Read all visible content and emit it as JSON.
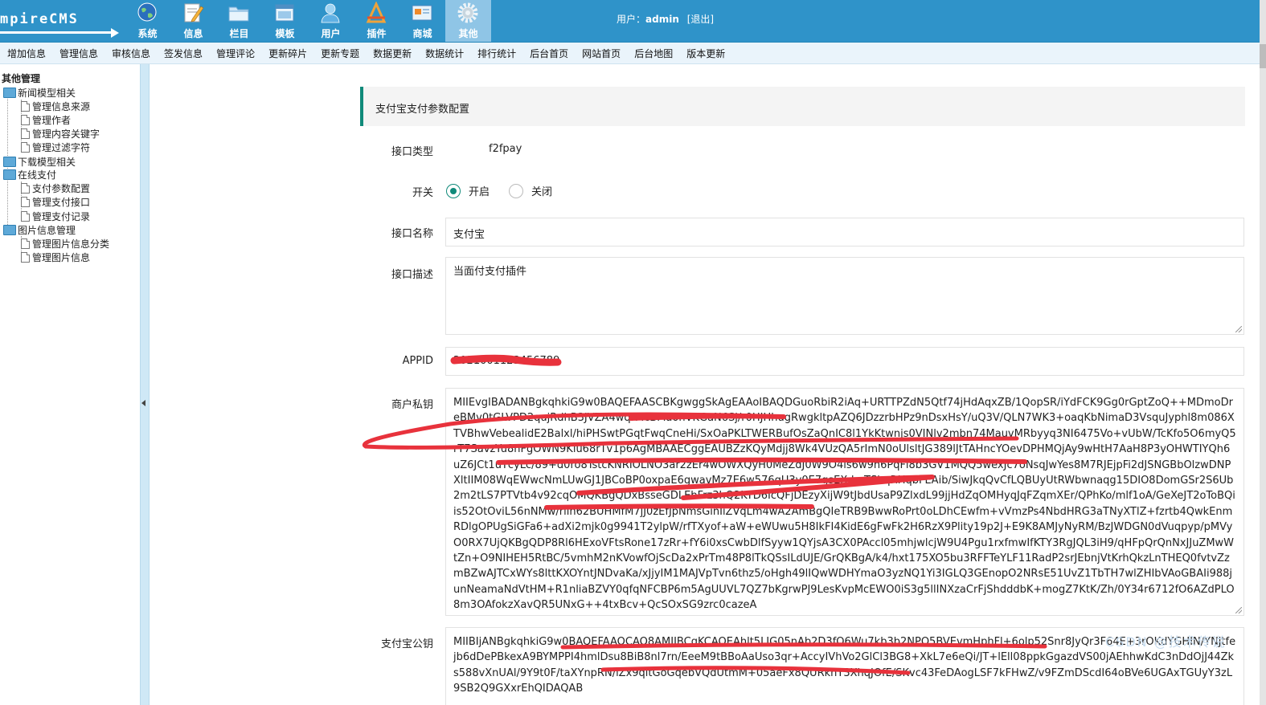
{
  "app": {
    "logo_text": "mpireCMS",
    "modules": [
      {
        "label": "系统",
        "icon": "globe-icon"
      },
      {
        "label": "信息",
        "icon": "pencil-note-icon"
      },
      {
        "label": "栏目",
        "icon": "folder-icon"
      },
      {
        "label": "模板",
        "icon": "window-icon"
      },
      {
        "label": "用户",
        "icon": "user-icon"
      },
      {
        "label": "插件",
        "icon": "tools-icon"
      },
      {
        "label": "商城",
        "icon": "shop-card-icon"
      },
      {
        "label": "其他",
        "icon": "gear-icon",
        "active": true
      }
    ],
    "user_prefix": "用户：",
    "username": "admin",
    "logout": "[退出]"
  },
  "subnav": [
    "增加信息",
    "管理信息",
    "审核信息",
    "签发信息",
    "管理评论",
    "更新碎片",
    "更新专题",
    "数据更新",
    "数据统计",
    "排行统计",
    "后台首页",
    "网站首页",
    "后台地图",
    "版本更新"
  ],
  "sidebar": {
    "title": "其他管理",
    "groups": [
      {
        "label": "新闻模型相关",
        "children": [
          "管理信息来源",
          "管理作者",
          "管理内容关键字",
          "管理过滤字符"
        ]
      },
      {
        "label": "下载模型相关",
        "children": []
      },
      {
        "label": "在线支付",
        "children": [
          "支付参数配置",
          "管理支付接口",
          "管理支付记录"
        ]
      },
      {
        "label": "图片信息管理",
        "children": [
          "管理图片信息分类",
          "管理图片信息"
        ]
      }
    ]
  },
  "form": {
    "section_title": "支付宝支付参数配置",
    "type_label": "接口类型",
    "type_value": "f2fpay",
    "switch_label": "开关",
    "switch_on": "开启",
    "switch_off": "关闭",
    "switch_selected": "on",
    "name_label": "接口名称",
    "name_value": "支付宝",
    "desc_label": "接口描述",
    "desc_value": "当面付支付插件",
    "appid_label": "APPID",
    "appid_value": "2021001123456789",
    "private_key_label": "商户私钥",
    "private_key_value": "MIIEvgIBADANBgkqhkiG9w0BAQEFAASCBKgwggSkAgEAAoIBAQDGuoRbiR2iAq+URTTPZdN5Qtf74jHdAqxZB/1QopSR/iYdFCK9Gg0rGptZoQ++MDmoDreBMv0tGLVPD2qujRdhB3JVZA4wqrMcBMaohVKGaN6Sj/r0HJHhugRwgkltpAZQ6JDzzrbHPz9nDsxHsY/uQ3V/QLN7WK3+oaqKbNimaD3VsquJyphl8m086XTVBhwVebealidE2Balxl/hiPHSwtPGqtFwqCneHi/SxOaPKLTWERBufOsZaQnIC8l1YkKtwnjs0VINlv2mbn74MauvMRbyyq3NI6475Vo+vUbW/TcKfo5O6myQ5rT7SavzYu8nFgOWN9Klu68rTv1p6AgMBAAECggEAUBZzKQyMdjj8Wk4VUzQA5rImN0oUlsltJG389lJtTAHncYOevDPHMQjAy9wHtH7AaH8P3yOHWTIYQh6uZ6JCt1uYcyLc/89+d0ro8TstcKNRIOLNO3ar2zEr4wOWXQyH0MeZdJ0W9O4ls6w9h6PqFl8b3GV1MQQ5wexJc7oNsqJwYes8M7RJEjpFi2dJSNGBbOlzwDNPXltIIM08WqEWwcNmLUwGJ1JBCoBP0oxpaE6gwavMz7E6w576qU3y0E7gsEXdcrTShqRHqbFEAib/SiwJkqQvCfLQBUyUtRWbwnaqg15DIO8DomGSr2S6Ub2m2tLS7PTVtb4v92cqOMQKBgQDxBsseGDLEbFrz3hQ2KTD6IcQFjDEzyXijW9tJbdUsaP9ZlxdL99jjHdZqOMHyqJqFZqmXEr/QPhKo/mlf1oA/GeXeJT2oToBQiis52OtOviL56nNMw/rlih62BUHMfM7jJ0zEfJpNmsGinIiZVqLm4wA2AmBgQIeTRB9BwwRoPrt0oLDhCEwfm+vVmzPs4NbdHRG3aTNyXTlZ+fzrtb4QwkEnmRDlgOPUgSiGFa6+adXi2mjk0g9941T2ylpW/rfTXyof+aW+eWUwu5H8IkFI4KidE6gFwFk2H6RzX9Plity19p2J+E9K8AMJyNyRM/BzJWDGN0dVuqpyp/pMVyO0RX7UjQKBgQDP8Rl6HExoVFtsRone17zRr+fY6i0xsCwbDlfSyyw1QYjsA3CX0PAccl05mhjwlcjW9U4Pgu1rxfmwIfKTY3RgJQL3iH9/qHFpQrQnNxJJuZMwWtZn+O9NIHEH5RtBC/5vmhM2nKVowfOjScDa2xPrTm48P8lTkQSsILdUJE/GrQKBgA/k4/hxt175XO5bu3RFFTeYLF11RadP2srJEbnjVtKrhQkzLnTHEQ0fvtvZzmBZwAJTCxWYs8lttKXOYntJNDvaKa/xJjyIM1MAJVpTvn6thz5/oHgh49lIQwWDHYmaO3yzNQ1Yi3IGLQ3GEnopO2NRsE51UvZ1TbTH7wlZHIbVAoGBAIi988junNeamaNdVtHM+R1nliaBZVY0qfqNFCBP6m5AgUUVL7QZ7bKgrwPJ9LesKvpMcEWO0iS3g5llINXzaCrFjShdddbK+mogZ7KtK/Zh/0Y34r6712fO6AZdPLO8m3OAfokzXavQR5UNxG++4txBcv+QcSOxSG9zrc0cazeA",
    "public_key_label": "支付宝公钥",
    "public_key_value": "MIIBIjANBgkqhkiG9w0BAQEFAAOCAQ8AMIIBCgKCAQEAhlt5LIG05nAb2D3fQ6Wu7kb3b2NPQ5BVEvmHphFl+6olp52Snr8JyQr3F64E+3rOKdYGHIN/YNjtfejb6dDePBkexA9BYMPPI4hmlDsu8BiB8nl7rn/EeeM9tBBoAaUso3qr+AccyIVhVo2GlCl3BG8+XkL7e6eQi/JT+lEll08ppkGgazdVS00jAEhhwKdC3nDdOjJ44Zks588vXnUAl/9Y9t0F/taXYnpRN/iZx9qltGoGqebVQdUtmM+05aeFx8QURknY3XhqJOfE/SKvc43FeDAogLSF7kFHwZ/v9FZmDScdI64oBVe6UGAxTGUyY3zL9SB2Q9GXxrEhQIDAQAB"
  },
  "watermark": "CSDN @技术传说",
  "colors": {
    "header": "#2f93c9",
    "accent": "#108a7a",
    "redact": "#e8323c"
  }
}
